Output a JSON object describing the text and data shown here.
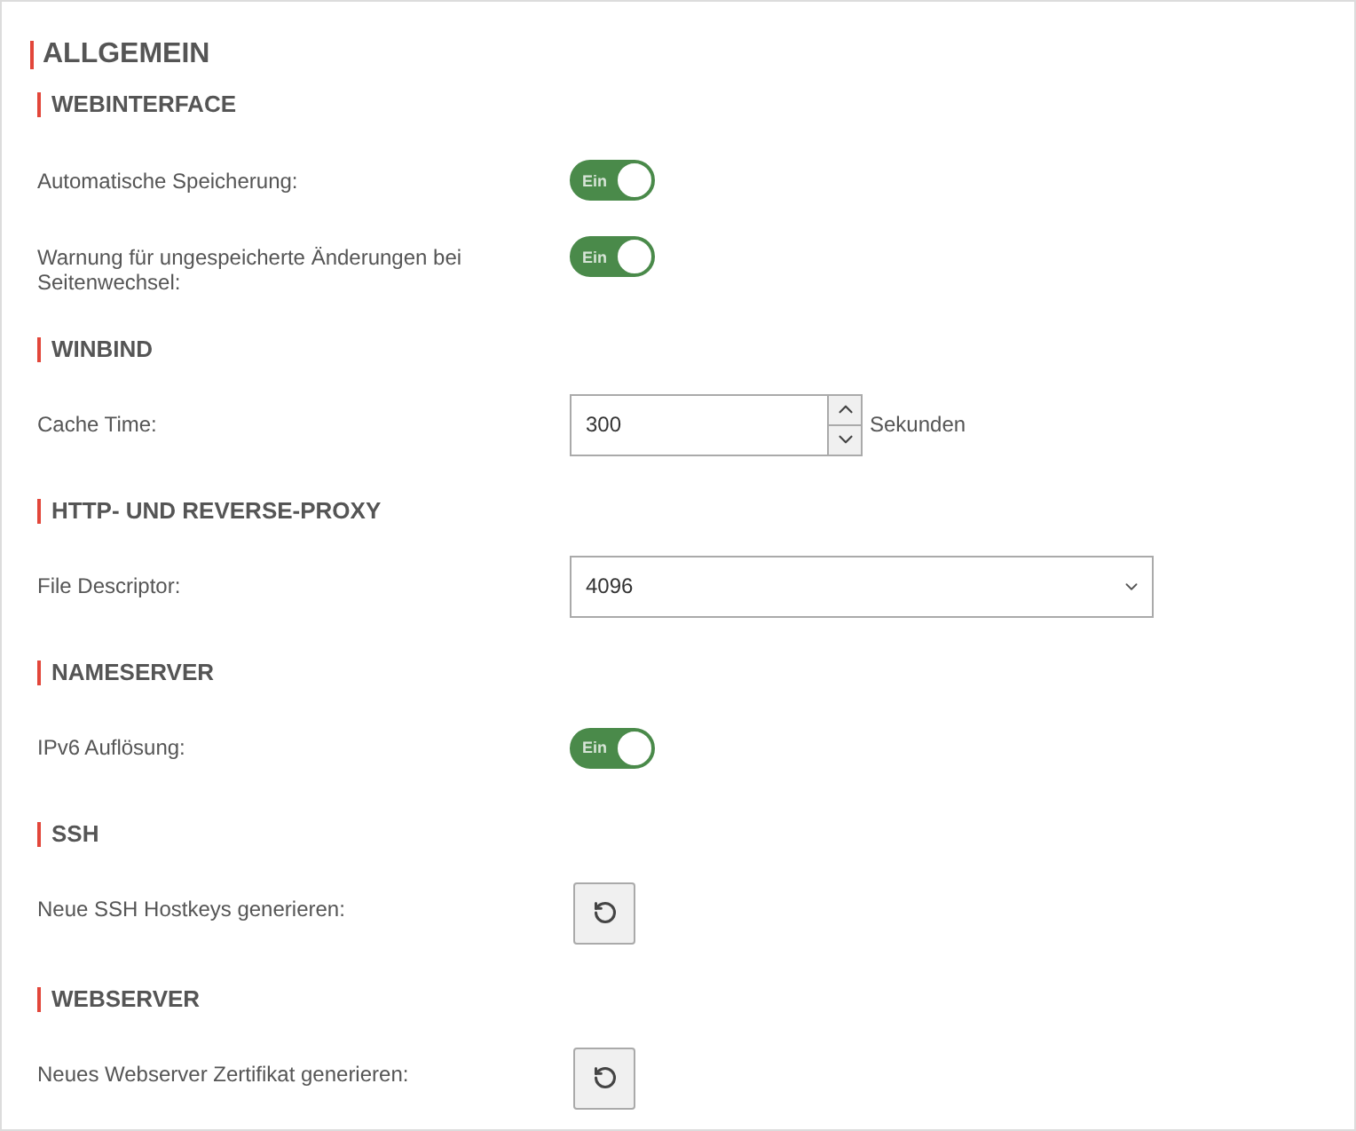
{
  "title": "ALLGEMEIN",
  "sections": [
    {
      "title": "WEBINTERFACE",
      "rows": [
        {
          "kind": "toggle",
          "label": "Automatische Speicherung:",
          "toggle": {
            "text": "Ein",
            "on": true
          }
        },
        {
          "kind": "toggle",
          "label": "Warnung für ungespeicherte Änderungen bei Seitenwechsel:",
          "toggle": {
            "text": "Ein",
            "on": true
          }
        }
      ]
    },
    {
      "title": "WINBIND",
      "rows": [
        {
          "kind": "number",
          "label": "Cache Time:",
          "value": "300",
          "unit": "Sekunden"
        }
      ]
    },
    {
      "title": "HTTP- UND REVERSE-PROXY",
      "rows": [
        {
          "kind": "select",
          "label": "File Descriptor:",
          "value": "4096"
        }
      ]
    },
    {
      "title": "NAMESERVER",
      "rows": [
        {
          "kind": "toggle",
          "label": "IPv6 Auflösung:",
          "toggle": {
            "text": "Ein",
            "on": true
          }
        }
      ]
    },
    {
      "title": "SSH",
      "rows": [
        {
          "kind": "button",
          "label": "Neue SSH Hostkeys generieren:"
        }
      ]
    },
    {
      "title": "WEBSERVER",
      "rows": [
        {
          "kind": "button",
          "label": "Neues Webserver Zertifikat generieren:"
        }
      ]
    }
  ]
}
